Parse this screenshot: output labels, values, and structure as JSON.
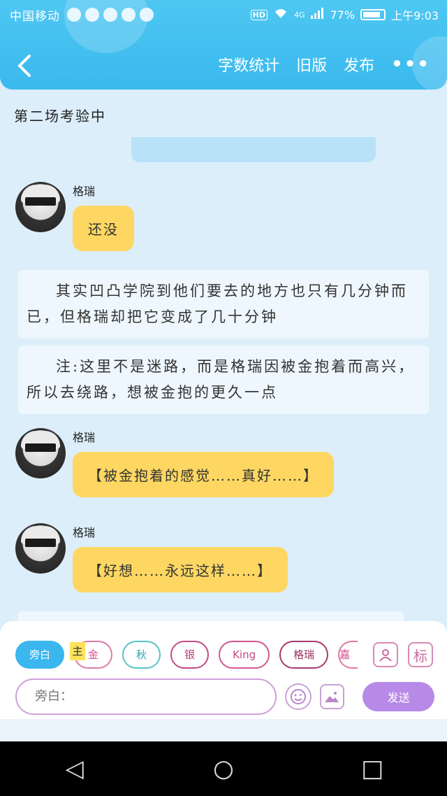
{
  "status": {
    "carrier": "中国移动",
    "network": "4G",
    "hd": "HD",
    "battery": "77%",
    "time": "上午9:03"
  },
  "topbar": {
    "back_icon": "chevron-left-icon",
    "actions": [
      "字数统计",
      "旧版",
      "发布"
    ],
    "more": "•••",
    "color": "#3ab9ee"
  },
  "chapter_title": "第二场考验中",
  "messages": [
    {
      "type": "dialog",
      "name": "格瑞",
      "text": "还没"
    },
    {
      "type": "narration",
      "text": "其实凹凸学院到他们要去的地方也只有几分钟而已，但格瑞却把它变成了几十分钟"
    },
    {
      "type": "narration",
      "text": "注:这里不是迷路，而是格瑞因被金抱着而高兴，所以去绕路，想被金抱的更久一点"
    },
    {
      "type": "dialog",
      "name": "格瑞",
      "text": "【被金抱着的感觉……真好……】"
    },
    {
      "type": "dialog",
      "name": "格瑞",
      "text": "【好想……永远这样……】"
    }
  ],
  "panel": {
    "chips": [
      "旁白",
      "金",
      "秋",
      "银",
      "King",
      "格瑞",
      "嘉"
    ],
    "zhu_tag": "主",
    "tag_icon_label": "标",
    "input_placeholder": "旁白：",
    "send_label": "发送"
  },
  "sysnav": {
    "back": "◁",
    "home": "○",
    "recent": "□"
  }
}
